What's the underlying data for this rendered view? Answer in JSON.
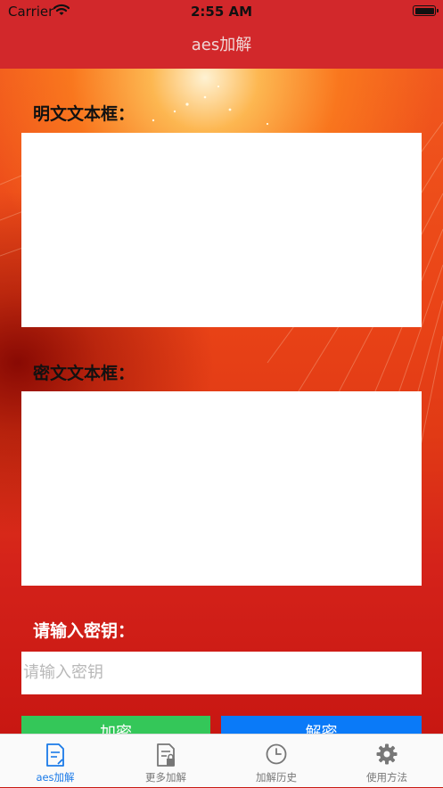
{
  "status_bar": {
    "carrier": "Carrier",
    "time": "2:55 AM"
  },
  "nav": {
    "title": "aes加解"
  },
  "form": {
    "plaintext_label": "明文文本框：",
    "ciphertext_label": "密文文本框：",
    "key_label": "请输入密钥：",
    "key_placeholder": "请输入密钥",
    "encrypt_label": "加密",
    "decrypt_label": "解密"
  },
  "tabs": [
    {
      "label": "aes加解",
      "icon": "document-edit-icon",
      "active": true
    },
    {
      "label": "更多加解",
      "icon": "document-lock-icon",
      "active": false
    },
    {
      "label": "加解历史",
      "icon": "clock-icon",
      "active": false
    },
    {
      "label": "使用方法",
      "icon": "gear-icon",
      "active": false
    }
  ],
  "colors": {
    "nav_bg": "#d2282b",
    "encrypt_button": "#34c759",
    "decrypt_button": "#0a7af8",
    "tab_active": "#1a7ae8",
    "tab_inactive": "#777777"
  }
}
